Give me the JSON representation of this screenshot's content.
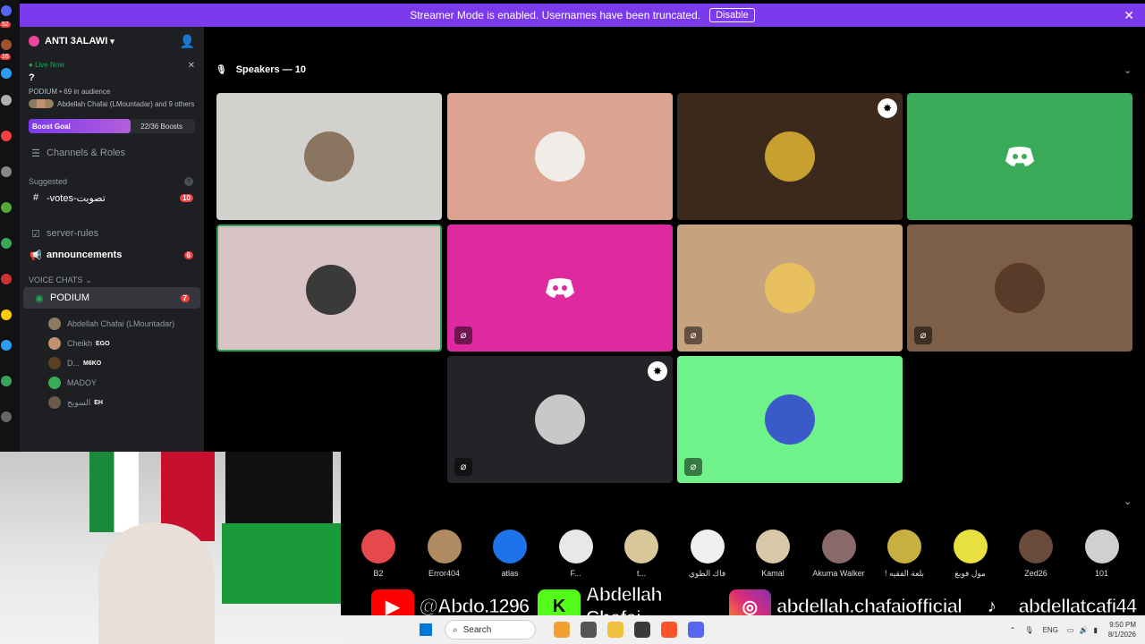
{
  "banner": {
    "text": "Streamer Mode is enabled. Usernames have been truncated.",
    "button": "Disable"
  },
  "sidebar": {
    "server_name": "ANTI 3ALAWI",
    "live_now": "Live Now",
    "stage_topic": "?",
    "stage_info": "PODIUM • 69 in audience",
    "participants": "Abdellah Chafai (LMountadar) and 9 others",
    "boost_label": "Boost Goal",
    "boost_count": "22/36 Boosts",
    "boost_progress": 0.611,
    "channels_roles": "Channels & Roles",
    "suggested": "Suggested",
    "votes_channel": "-votes-تصويت",
    "votes_count": "10",
    "server_rules": "server-rules",
    "announcements": "announcements",
    "announcements_count": "6",
    "voice_chats": "VOICE CHATS",
    "podium": "PODIUM",
    "podium_count": "7",
    "members": [
      {
        "name": "Abdellah Chafai (LMountadar)",
        "tag": ""
      },
      {
        "name": "Cheikh",
        "tag": "EGO"
      },
      {
        "name": "D...",
        "tag": "M6KO"
      },
      {
        "name": "MADOY",
        "tag": ""
      },
      {
        "name": "السويح",
        "tag": "EH"
      }
    ]
  },
  "stage": {
    "speakers_label": "Speakers — 10",
    "colors": [
      "#d3d1ce",
      "#dca390",
      "#3b2a1c",
      "#3aab58",
      "#d8c3c5",
      "#df2a9f",
      "#c6a27e",
      "#7d5e48",
      "#232428",
      "#6ef289"
    ]
  },
  "audience": [
    {
      "name": "B2",
      "color": "#e5484d"
    },
    {
      "name": "Error404",
      "color": "#b08a60"
    },
    {
      "name": "atlas",
      "color": "#1e73e8"
    },
    {
      "name": "F...",
      "color": "#e8e8e8"
    },
    {
      "name": "t...",
      "color": "#d8c89a"
    },
    {
      "name": "فاك الطوي",
      "color": "#f0f0f0"
    },
    {
      "name": "Kamal",
      "color": "#d8c8a8"
    },
    {
      "name": "Akuma Walker",
      "color": "#8a6a6a"
    },
    {
      "name": "! بلعة الفقيه",
      "color": "#c8b040"
    },
    {
      "name": "مول فوبغ",
      "color": "#e8e040"
    },
    {
      "name": "Zed26",
      "color": "#6a4a3a"
    },
    {
      "name": "101",
      "color": "#d0d0d0"
    }
  ],
  "social": {
    "youtube": "@Abdo.1296",
    "kick": "Abdellah Chafai",
    "instagram": "abdellah.chafaiofficial",
    "tiktok": "abdellatcafi44"
  },
  "taskbar": {
    "search": "Search",
    "lang": "ENG",
    "time": "9:50 PM",
    "date": "8/1/2026"
  }
}
